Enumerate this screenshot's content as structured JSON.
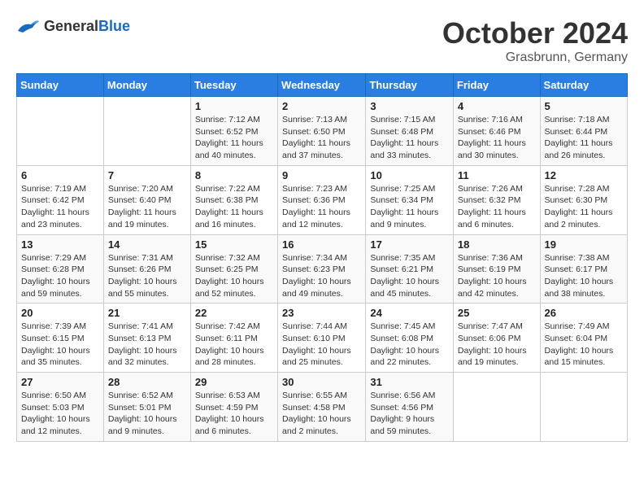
{
  "header": {
    "logo": {
      "general": "General",
      "blue": "Blue"
    },
    "title": "October 2024",
    "location": "Grasbrunn, Germany"
  },
  "weekdays": [
    "Sunday",
    "Monday",
    "Tuesday",
    "Wednesday",
    "Thursday",
    "Friday",
    "Saturday"
  ],
  "weeks": [
    [
      {
        "day": "",
        "sunrise": "",
        "sunset": "",
        "daylight": ""
      },
      {
        "day": "",
        "sunrise": "",
        "sunset": "",
        "daylight": ""
      },
      {
        "day": "1",
        "sunrise": "Sunrise: 7:12 AM",
        "sunset": "Sunset: 6:52 PM",
        "daylight": "Daylight: 11 hours and 40 minutes."
      },
      {
        "day": "2",
        "sunrise": "Sunrise: 7:13 AM",
        "sunset": "Sunset: 6:50 PM",
        "daylight": "Daylight: 11 hours and 37 minutes."
      },
      {
        "day": "3",
        "sunrise": "Sunrise: 7:15 AM",
        "sunset": "Sunset: 6:48 PM",
        "daylight": "Daylight: 11 hours and 33 minutes."
      },
      {
        "day": "4",
        "sunrise": "Sunrise: 7:16 AM",
        "sunset": "Sunset: 6:46 PM",
        "daylight": "Daylight: 11 hours and 30 minutes."
      },
      {
        "day": "5",
        "sunrise": "Sunrise: 7:18 AM",
        "sunset": "Sunset: 6:44 PM",
        "daylight": "Daylight: 11 hours and 26 minutes."
      }
    ],
    [
      {
        "day": "6",
        "sunrise": "Sunrise: 7:19 AM",
        "sunset": "Sunset: 6:42 PM",
        "daylight": "Daylight: 11 hours and 23 minutes."
      },
      {
        "day": "7",
        "sunrise": "Sunrise: 7:20 AM",
        "sunset": "Sunset: 6:40 PM",
        "daylight": "Daylight: 11 hours and 19 minutes."
      },
      {
        "day": "8",
        "sunrise": "Sunrise: 7:22 AM",
        "sunset": "Sunset: 6:38 PM",
        "daylight": "Daylight: 11 hours and 16 minutes."
      },
      {
        "day": "9",
        "sunrise": "Sunrise: 7:23 AM",
        "sunset": "Sunset: 6:36 PM",
        "daylight": "Daylight: 11 hours and 12 minutes."
      },
      {
        "day": "10",
        "sunrise": "Sunrise: 7:25 AM",
        "sunset": "Sunset: 6:34 PM",
        "daylight": "Daylight: 11 hours and 9 minutes."
      },
      {
        "day": "11",
        "sunrise": "Sunrise: 7:26 AM",
        "sunset": "Sunset: 6:32 PM",
        "daylight": "Daylight: 11 hours and 6 minutes."
      },
      {
        "day": "12",
        "sunrise": "Sunrise: 7:28 AM",
        "sunset": "Sunset: 6:30 PM",
        "daylight": "Daylight: 11 hours and 2 minutes."
      }
    ],
    [
      {
        "day": "13",
        "sunrise": "Sunrise: 7:29 AM",
        "sunset": "Sunset: 6:28 PM",
        "daylight": "Daylight: 10 hours and 59 minutes."
      },
      {
        "day": "14",
        "sunrise": "Sunrise: 7:31 AM",
        "sunset": "Sunset: 6:26 PM",
        "daylight": "Daylight: 10 hours and 55 minutes."
      },
      {
        "day": "15",
        "sunrise": "Sunrise: 7:32 AM",
        "sunset": "Sunset: 6:25 PM",
        "daylight": "Daylight: 10 hours and 52 minutes."
      },
      {
        "day": "16",
        "sunrise": "Sunrise: 7:34 AM",
        "sunset": "Sunset: 6:23 PM",
        "daylight": "Daylight: 10 hours and 49 minutes."
      },
      {
        "day": "17",
        "sunrise": "Sunrise: 7:35 AM",
        "sunset": "Sunset: 6:21 PM",
        "daylight": "Daylight: 10 hours and 45 minutes."
      },
      {
        "day": "18",
        "sunrise": "Sunrise: 7:36 AM",
        "sunset": "Sunset: 6:19 PM",
        "daylight": "Daylight: 10 hours and 42 minutes."
      },
      {
        "day": "19",
        "sunrise": "Sunrise: 7:38 AM",
        "sunset": "Sunset: 6:17 PM",
        "daylight": "Daylight: 10 hours and 38 minutes."
      }
    ],
    [
      {
        "day": "20",
        "sunrise": "Sunrise: 7:39 AM",
        "sunset": "Sunset: 6:15 PM",
        "daylight": "Daylight: 10 hours and 35 minutes."
      },
      {
        "day": "21",
        "sunrise": "Sunrise: 7:41 AM",
        "sunset": "Sunset: 6:13 PM",
        "daylight": "Daylight: 10 hours and 32 minutes."
      },
      {
        "day": "22",
        "sunrise": "Sunrise: 7:42 AM",
        "sunset": "Sunset: 6:11 PM",
        "daylight": "Daylight: 10 hours and 28 minutes."
      },
      {
        "day": "23",
        "sunrise": "Sunrise: 7:44 AM",
        "sunset": "Sunset: 6:10 PM",
        "daylight": "Daylight: 10 hours and 25 minutes."
      },
      {
        "day": "24",
        "sunrise": "Sunrise: 7:45 AM",
        "sunset": "Sunset: 6:08 PM",
        "daylight": "Daylight: 10 hours and 22 minutes."
      },
      {
        "day": "25",
        "sunrise": "Sunrise: 7:47 AM",
        "sunset": "Sunset: 6:06 PM",
        "daylight": "Daylight: 10 hours and 19 minutes."
      },
      {
        "day": "26",
        "sunrise": "Sunrise: 7:49 AM",
        "sunset": "Sunset: 6:04 PM",
        "daylight": "Daylight: 10 hours and 15 minutes."
      }
    ],
    [
      {
        "day": "27",
        "sunrise": "Sunrise: 6:50 AM",
        "sunset": "Sunset: 5:03 PM",
        "daylight": "Daylight: 10 hours and 12 minutes."
      },
      {
        "day": "28",
        "sunrise": "Sunrise: 6:52 AM",
        "sunset": "Sunset: 5:01 PM",
        "daylight": "Daylight: 10 hours and 9 minutes."
      },
      {
        "day": "29",
        "sunrise": "Sunrise: 6:53 AM",
        "sunset": "Sunset: 4:59 PM",
        "daylight": "Daylight: 10 hours and 6 minutes."
      },
      {
        "day": "30",
        "sunrise": "Sunrise: 6:55 AM",
        "sunset": "Sunset: 4:58 PM",
        "daylight": "Daylight: 10 hours and 2 minutes."
      },
      {
        "day": "31",
        "sunrise": "Sunrise: 6:56 AM",
        "sunset": "Sunset: 4:56 PM",
        "daylight": "Daylight: 9 hours and 59 minutes."
      },
      {
        "day": "",
        "sunrise": "",
        "sunset": "",
        "daylight": ""
      },
      {
        "day": "",
        "sunrise": "",
        "sunset": "",
        "daylight": ""
      }
    ]
  ]
}
